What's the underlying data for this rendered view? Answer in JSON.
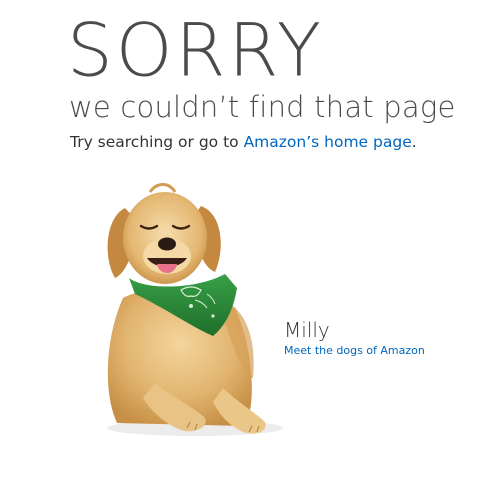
{
  "header": {
    "title": "SORRY",
    "subtitle": "we couldn’t find that page",
    "help_prefix": "Try searching or go to ",
    "help_link": "Amazon’s home page",
    "help_suffix": "."
  },
  "dog_card": {
    "name": "Milly",
    "link_text": "Meet the dogs of Amazon"
  },
  "colors": {
    "title": "#4b4b4b",
    "link": "#0066c0",
    "bandana": "#2e8b3a",
    "fur": "#e2b46f"
  },
  "images": {
    "dog": "golden-retriever-with-green-bandana"
  }
}
